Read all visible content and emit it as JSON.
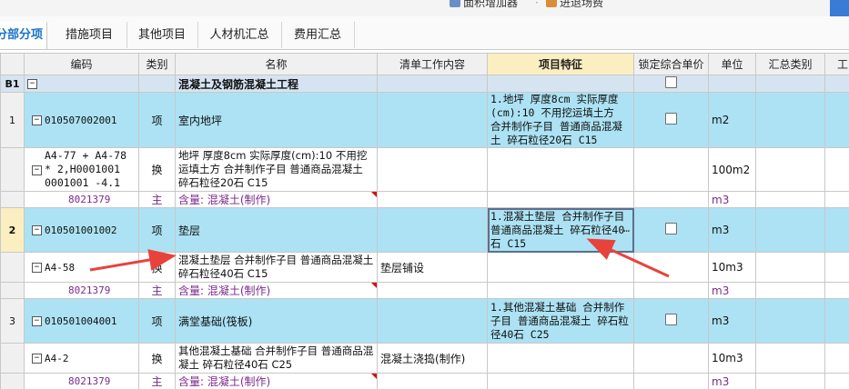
{
  "toolbar": {
    "item1": "面积增加器",
    "item2": "进退场费"
  },
  "tabs": [
    {
      "label": "分部分项",
      "active": true
    },
    {
      "label": "措施项目"
    },
    {
      "label": "其他项目"
    },
    {
      "label": "人材机汇总"
    },
    {
      "label": "费用汇总"
    }
  ],
  "columns": [
    "编码",
    "类别",
    "名称",
    "清单工作内容",
    "项目特征",
    "锁定综合单价",
    "单位",
    "汇总类别",
    "工"
  ],
  "rows": {
    "b1": {
      "no": "B1",
      "name": "混凝土及钢筋混凝土工程"
    },
    "item1": {
      "no": "1",
      "code": "010507002001",
      "type": "项",
      "name": "室内地坪",
      "feature": "1.地坪 厚度8cm  实际厚度(cm):10  不用挖运填土方  合并制作子目 普通商品混凝土 碎石粒径20石 C15",
      "unit": "m2"
    },
    "sub1": {
      "code": "A4-77 + A4-78 * 2,H0001001 0001001 -4.1",
      "type": "换",
      "name": "地坪 厚度8cm  实际厚度(cm):10  不用挖运填土方  合并制作子目 普通商品混凝土 碎石粒径20石 C15",
      "unit": "100m2"
    },
    "mat1": {
      "code": "8021379",
      "type": "主",
      "name": "含量: 混凝土(制作)",
      "unit": "m3"
    },
    "item2": {
      "no": "2",
      "code": "010501001002",
      "type": "项",
      "name": "垫层",
      "feature": "1.混凝土垫层  合并制作子目 普通商品混凝土 碎石粒径40石 C15",
      "dots": "…",
      "unit": "m3"
    },
    "sub2": {
      "code": "A4-58",
      "type": "换",
      "name": "混凝土垫层  合并制作子目 普通商品混凝土 碎石粒径40石 C15",
      "work": "垫层铺设",
      "unit": "10m3"
    },
    "mat2": {
      "code": "8021379",
      "type": "主",
      "name": "含量: 混凝土(制作)",
      "unit": "m3"
    },
    "item3": {
      "no": "3",
      "code": "010501004001",
      "type": "项",
      "name": "满堂基础(筏板)",
      "feature": "1.其他混凝土基础  合并制作子目 普通商品混凝土 碎石粒径40石 C25",
      "unit": "m3"
    },
    "sub3": {
      "code": "A4-2",
      "type": "换",
      "name": "其他混凝土基础  合并制作子目 普通商品混凝土 碎石粒径40石 C25",
      "work": "混凝土浇捣(制作)",
      "unit": "10m3"
    },
    "mat3": {
      "code": "8021379",
      "type": "主",
      "name": "含量: 混凝土(制作)",
      "unit": "m3"
    }
  },
  "colors": {
    "item_row": "#ace2f4",
    "header_highlight": "#fbeec1",
    "arrow": "#e8423c",
    "material_text": "#7b2a8c"
  }
}
